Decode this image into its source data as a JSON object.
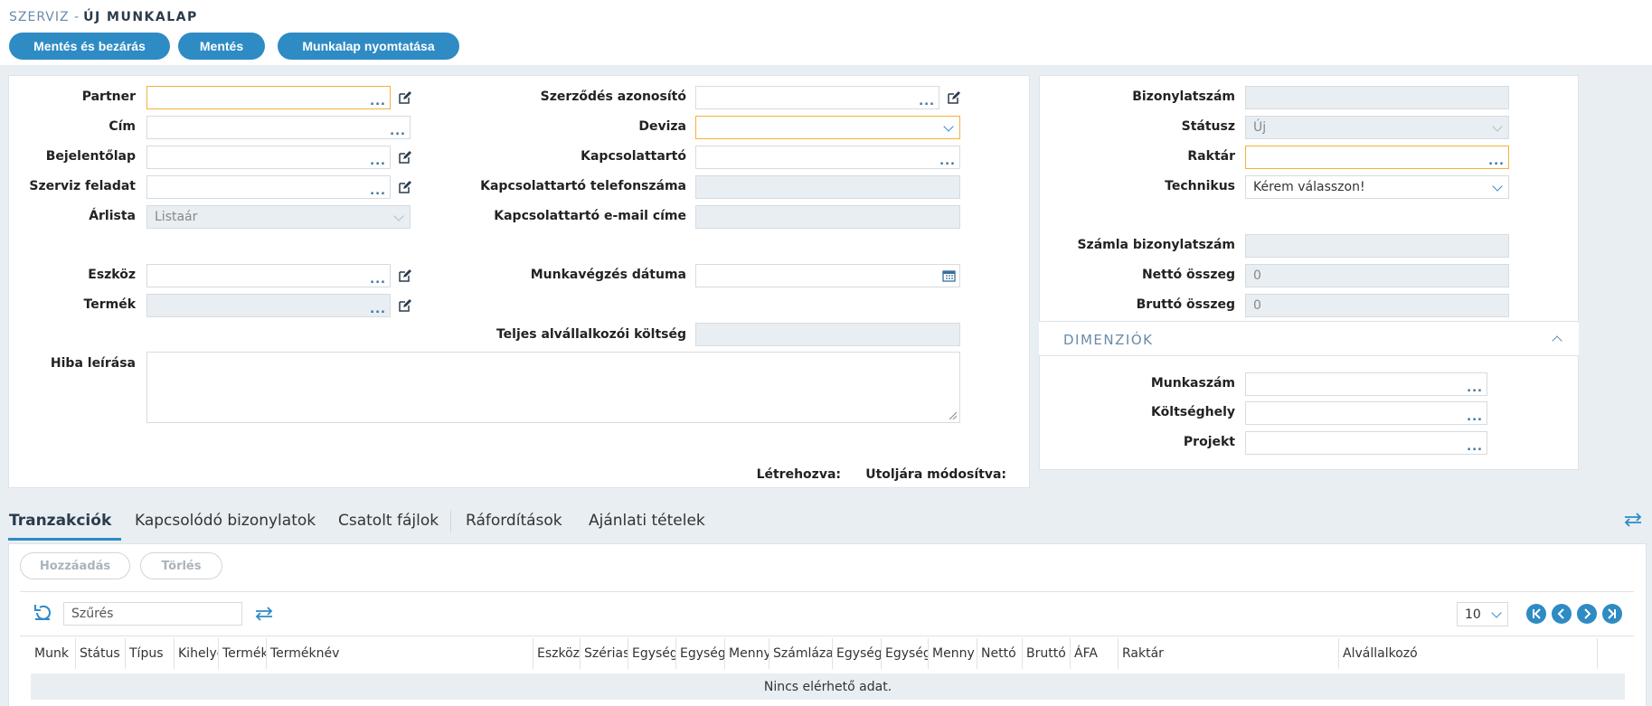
{
  "header": {
    "breadcrumb_module": "SZERVIZ -",
    "page_title": "ÚJ MUNKALAP",
    "buttons": {
      "save_close": "Mentés és bezárás",
      "save": "Mentés",
      "print": "Munkalap nyomtatása"
    }
  },
  "form": {
    "partner": {
      "label": "Partner",
      "value": ""
    },
    "address": {
      "label": "Cím",
      "value": ""
    },
    "report_sheet": {
      "label": "Bejelentőlap",
      "value": ""
    },
    "service_task": {
      "label": "Szerviz feladat",
      "value": ""
    },
    "price_list": {
      "label": "Árlista",
      "value": "Listaár"
    },
    "device": {
      "label": "Eszköz",
      "value": ""
    },
    "product": {
      "label": "Termék",
      "value": ""
    },
    "fault_desc": {
      "label": "Hiba leírása",
      "value": ""
    },
    "contract_id": {
      "label": "Szerződés azonosító",
      "value": ""
    },
    "currency": {
      "label": "Deviza",
      "value": ""
    },
    "contact": {
      "label": "Kapcsolattartó",
      "value": ""
    },
    "contact_phone": {
      "label": "Kapcsolattartó telefonszáma",
      "value": ""
    },
    "contact_email": {
      "label": "Kapcsolattartó e-mail címe",
      "value": ""
    },
    "work_date": {
      "label": "Munkavégzés dátuma",
      "value": ""
    },
    "subcontractor_cost": {
      "label": "Teljes alvállalkozói költség",
      "value": ""
    },
    "created_label": "Létrehozva:",
    "modified_label": "Utoljára módosítva:"
  },
  "side": {
    "doc_number": {
      "label": "Bizonylatszám",
      "value": ""
    },
    "status": {
      "label": "Státusz",
      "value": "Új"
    },
    "warehouse": {
      "label": "Raktár",
      "value": ""
    },
    "technician": {
      "label": "Technikus",
      "value": "Kérem válasszon!"
    },
    "invoice_number": {
      "label": "Számla bizonylatszám",
      "value": ""
    },
    "net_amount": {
      "label": "Nettó összeg",
      "value": "0"
    },
    "gross_amount": {
      "label": "Bruttó összeg",
      "value": "0"
    },
    "dimensions_title": "DIMENZIÓK",
    "work_number": {
      "label": "Munkaszám",
      "value": ""
    },
    "cost_center": {
      "label": "Költséghely",
      "value": ""
    },
    "project": {
      "label": "Projekt",
      "value": ""
    }
  },
  "tabs": [
    "Tranzakciók",
    "Kapcsolódó bizonylatok",
    "Csatolt fájlok",
    "Ráfordítások",
    "Ajánlati tételek"
  ],
  "grid": {
    "add_label": "Hozzáadás",
    "delete_label": "Törlés",
    "filter_placeholder": "Szűrés",
    "page_size": "10",
    "columns": [
      "Munk",
      "Státus",
      "Típus",
      "Kihelyez",
      "Termék",
      "Terméknév",
      "Eszköz",
      "Szériasz",
      "Egység",
      "Egység",
      "Menny",
      "Számlázan",
      "Egység",
      "Egység",
      "Menny",
      "Nettó",
      "Bruttó",
      "ÁFA",
      "Raktár",
      "Alvállalkozó"
    ],
    "empty_text": "Nincs elérhető adat."
  },
  "colors": {
    "accent": "#2e8bc4",
    "required": "#f0b33c",
    "disabled": "#e9eef2"
  }
}
